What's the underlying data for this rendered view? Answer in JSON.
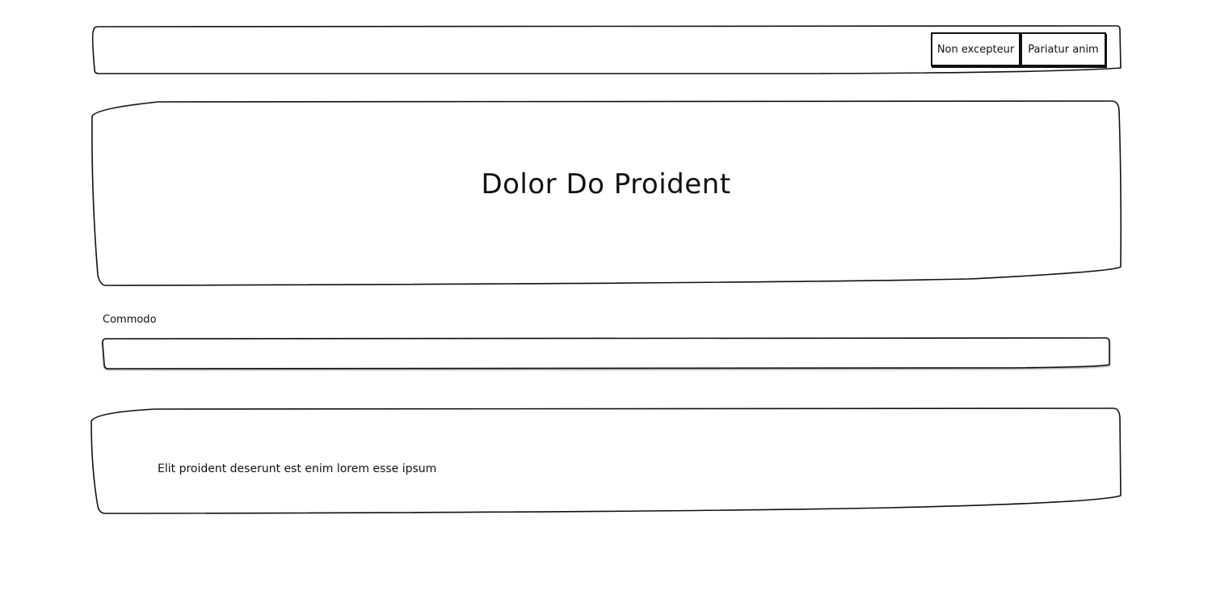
{
  "nav": {
    "buttons": [
      {
        "label": "Non excepteur"
      },
      {
        "label": "Pariatur anim"
      }
    ]
  },
  "hero": {
    "title": "Dolor Do Proident"
  },
  "form": {
    "field_label": "Commodo",
    "field_value": "",
    "field_placeholder": ""
  },
  "content": {
    "text": "Elit proident deserunt est enim lorem esse ipsum"
  }
}
